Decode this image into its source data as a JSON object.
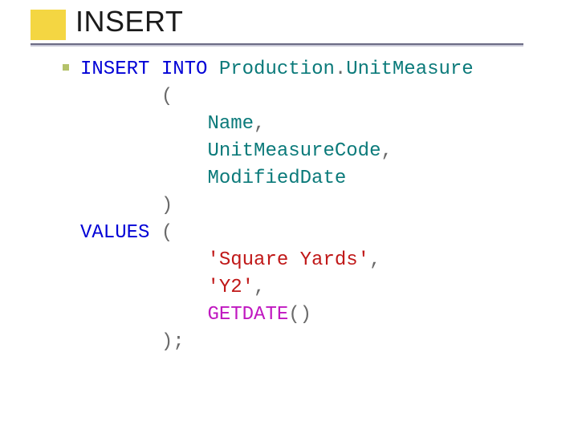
{
  "title": "INSERT",
  "code": {
    "kw_insert": "INSERT",
    "kw_into": "INTO",
    "schema": "Production",
    "dot": ".",
    "table": "UnitMeasure",
    "open_paren": "(",
    "col1": "Name",
    "comma": ",",
    "col2": "UnitMeasureCode",
    "col3": "ModifiedDate",
    "close_paren": ")",
    "kw_values": "VALUES",
    "val1": "'Square Yards'",
    "val2": "'Y2'",
    "fn_getdate": "GETDATE",
    "fn_parens": "()",
    "end": ");"
  }
}
